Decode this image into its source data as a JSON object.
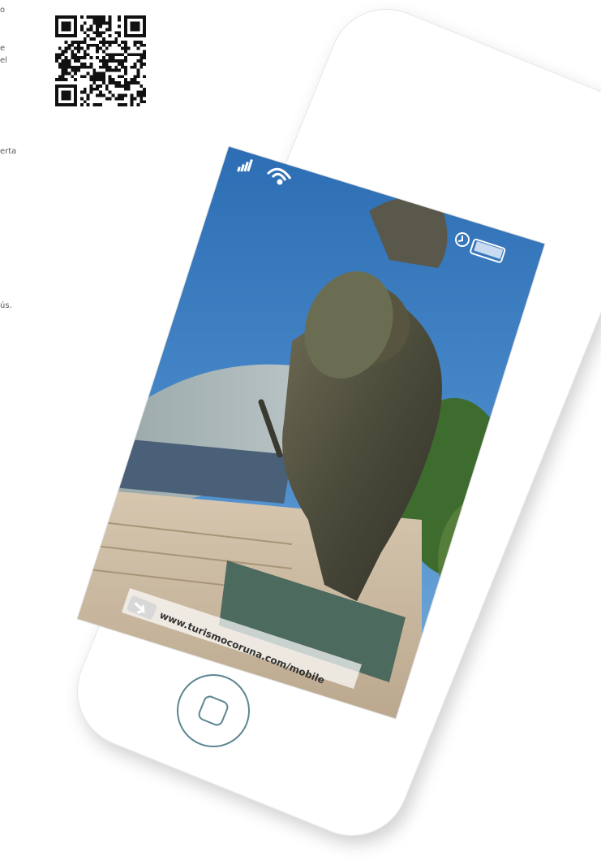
{
  "left_fragments": [
    {
      "id": "frag-1",
      "text": "o"
    },
    {
      "id": "frag-2",
      "text": "e"
    },
    {
      "id": "frag-3",
      "text": "el"
    },
    {
      "id": "frag-4",
      "text": "erta"
    },
    {
      "id": "frag-5",
      "text": "ús."
    }
  ],
  "phone": {
    "url_text": "www.turismocoruna.com/mobile"
  },
  "colors": {
    "sky_top": "#1f5fa8",
    "sky_bottom": "#6aa7d9",
    "phone_body": "#ffffff",
    "home_button": "#5d8593"
  }
}
